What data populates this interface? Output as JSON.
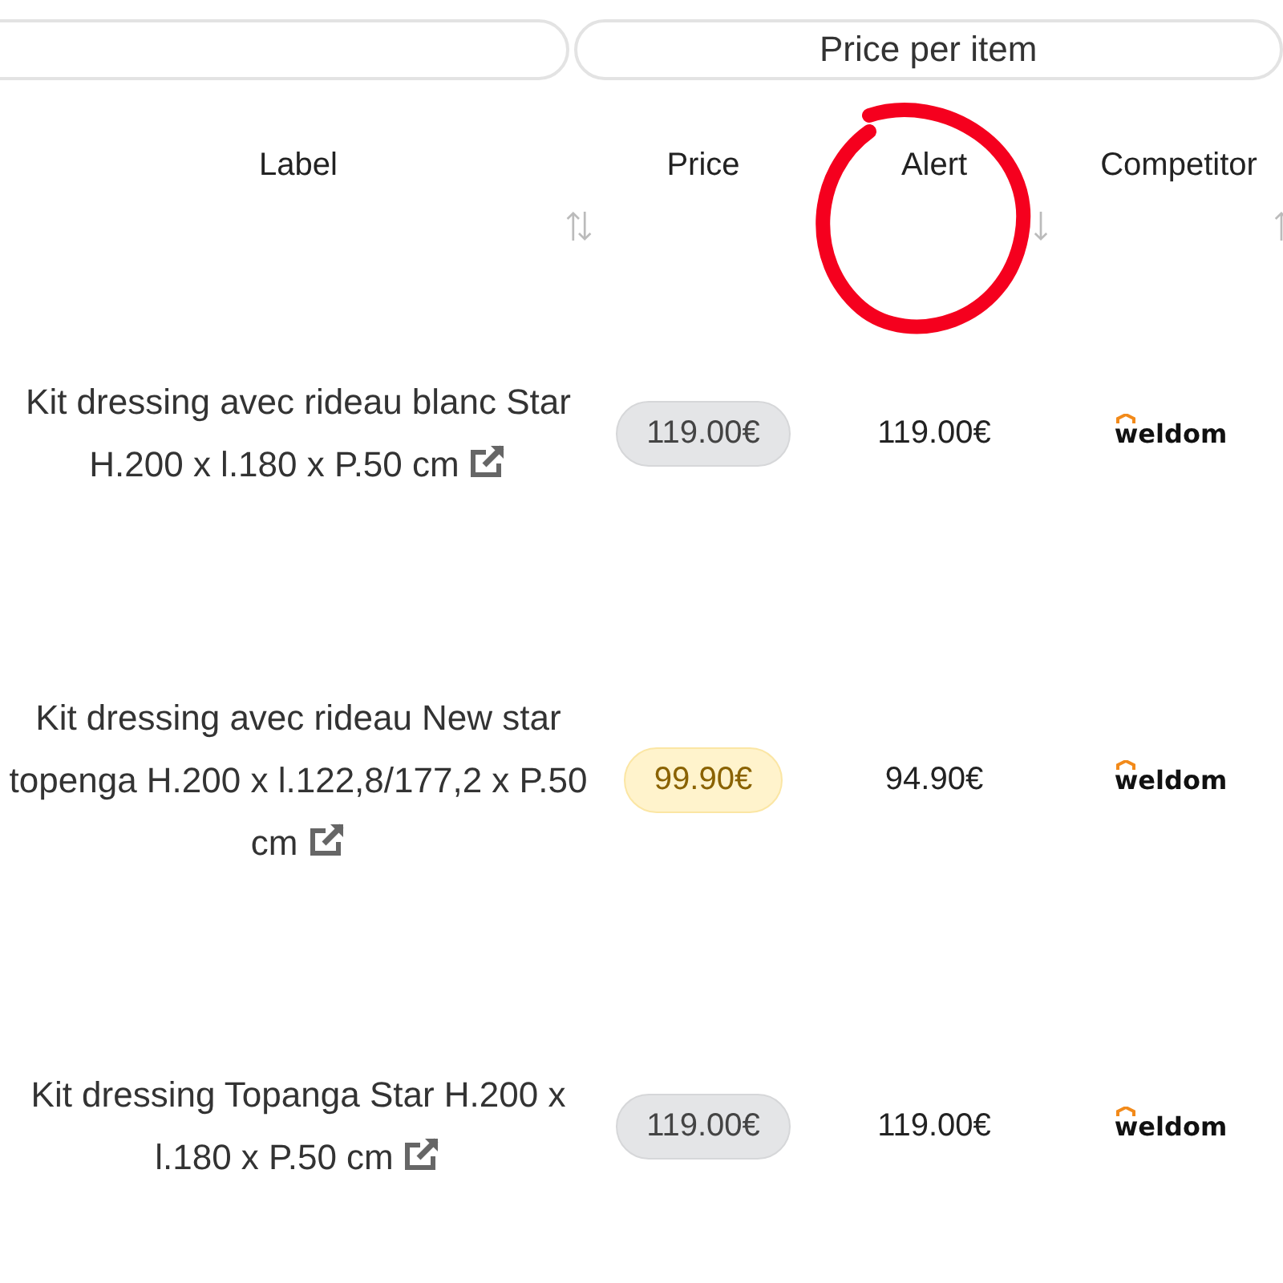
{
  "group_headers": [
    {
      "kind": "blank"
    },
    {
      "kind": "titled",
      "label": "Price per item"
    }
  ],
  "columns": [
    {
      "label": "Label",
      "kind": "both"
    },
    {
      "label": "Price",
      "kind": "none"
    },
    {
      "label": "Alert",
      "kind": "down"
    },
    {
      "label": "Competitor",
      "kind": "up"
    }
  ],
  "rows": [
    {
      "label": "Kit dressing avec rideau blanc Star H.200 x l.180 x P.50 cm",
      "price": "119.00€",
      "price_alert": false,
      "alert": "119.00€",
      "competitor": "weldom"
    },
    {
      "label": "Kit dressing avec rideau New star topenga H.200 x l.122,8/177,2 x P.50 cm",
      "price": "99.90€",
      "price_alert": true,
      "alert": "94.90€",
      "competitor": "weldom"
    },
    {
      "label": "Kit dressing Topanga Star H.200 x l.180 x P.50 cm",
      "price": "119.00€",
      "price_alert": false,
      "alert": "119.00€",
      "competitor": "weldom"
    }
  ]
}
